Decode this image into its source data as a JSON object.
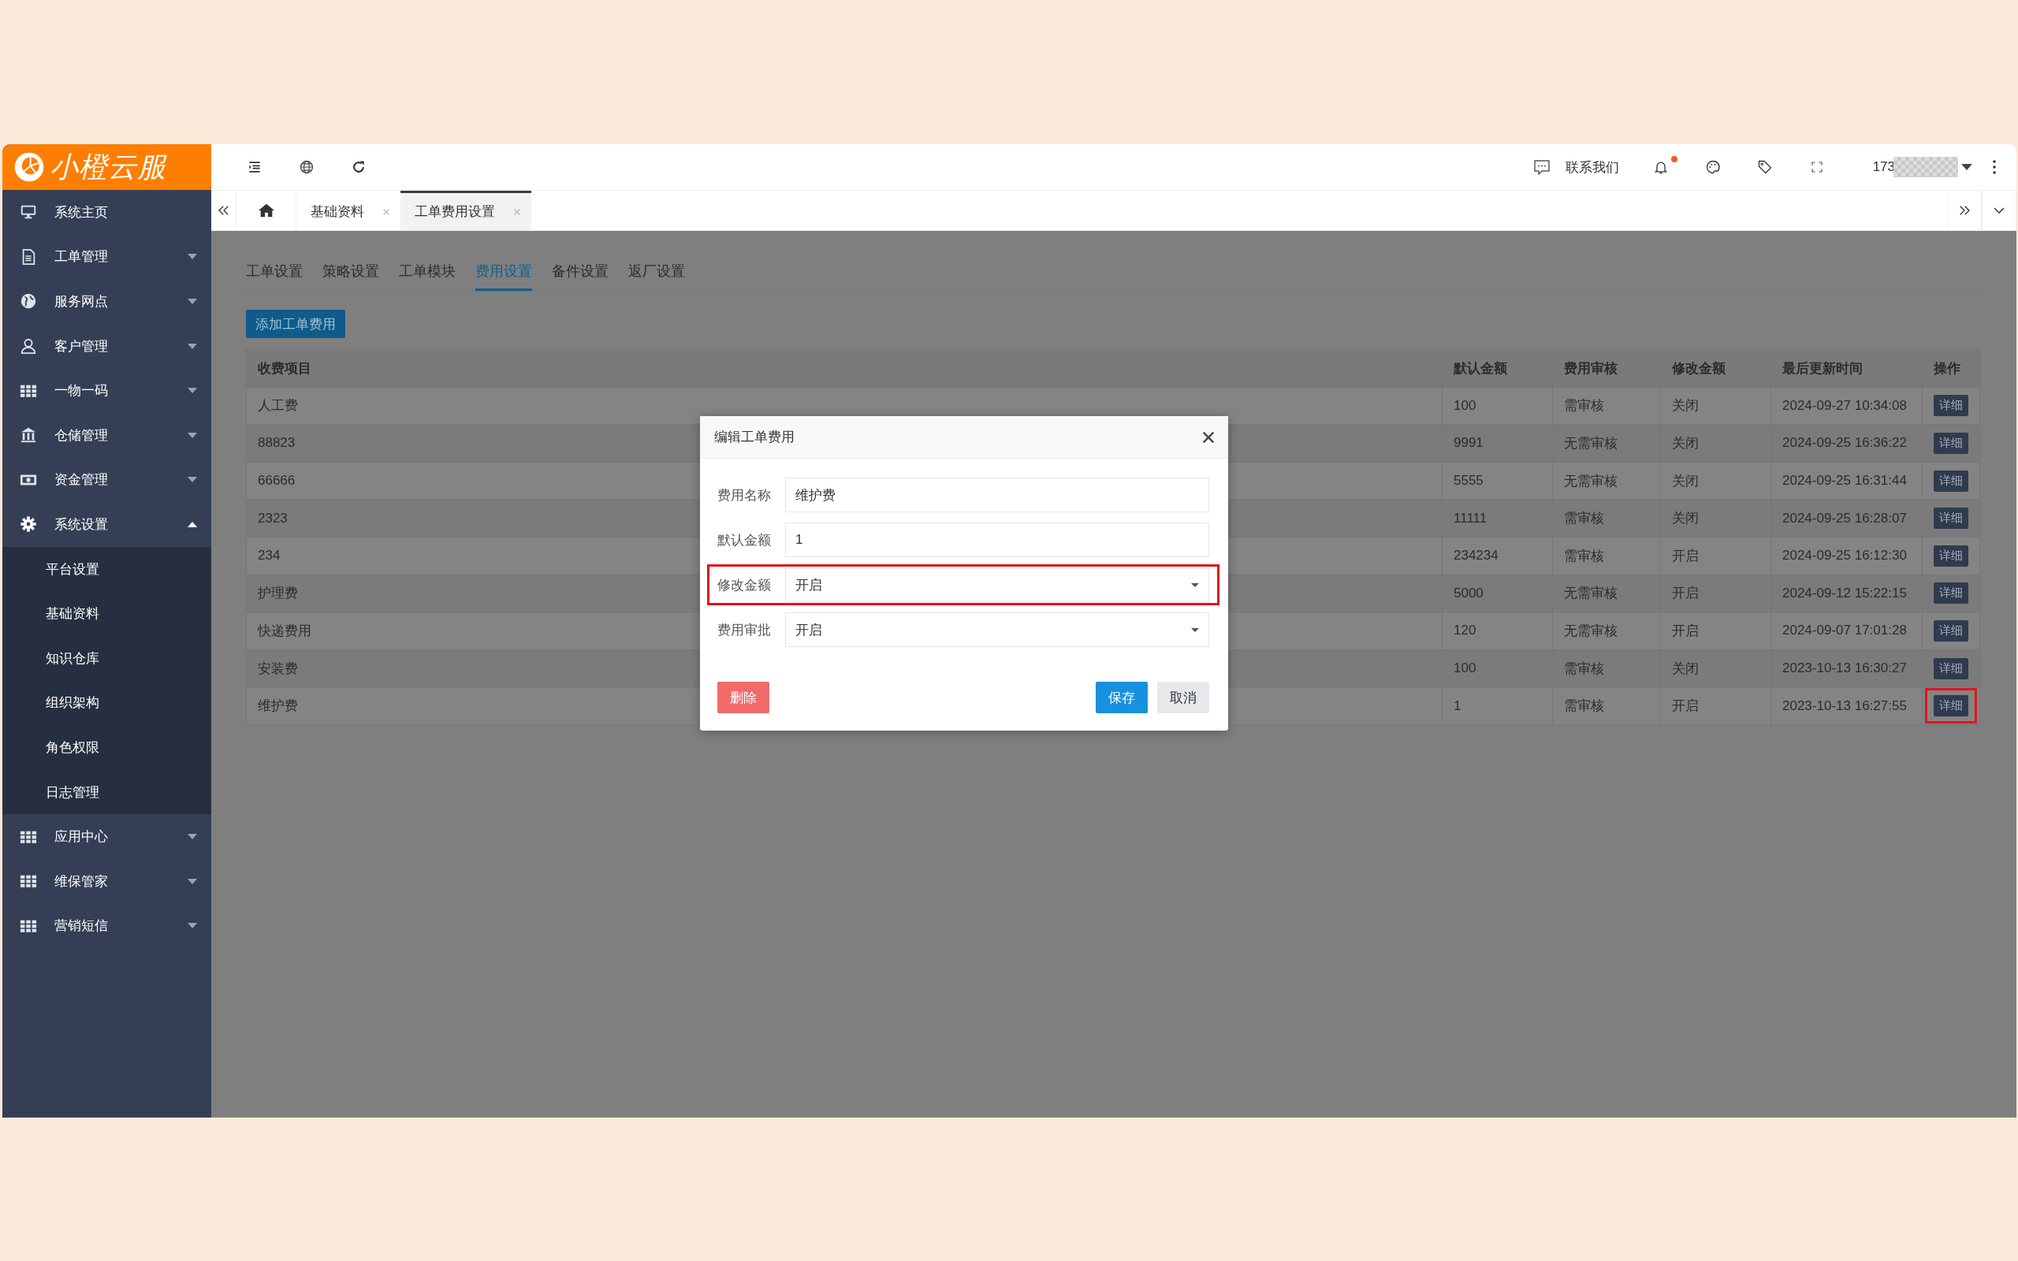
{
  "brand": {
    "name": "小橙云服"
  },
  "sidebar": {
    "items": [
      {
        "label": "系统主页",
        "kind": "link"
      },
      {
        "label": "工单管理",
        "kind": "menu",
        "expanded": false
      },
      {
        "label": "服务网点",
        "kind": "menu",
        "expanded": false
      },
      {
        "label": "客户管理",
        "kind": "menu",
        "expanded": false
      },
      {
        "label": "一物一码",
        "kind": "menu",
        "expanded": false
      },
      {
        "label": "仓储管理",
        "kind": "menu",
        "expanded": false
      },
      {
        "label": "资金管理",
        "kind": "menu",
        "expanded": false
      },
      {
        "label": "系统设置",
        "kind": "menu",
        "expanded": true,
        "children": [
          {
            "label": "平台设置"
          },
          {
            "label": "基础资料"
          },
          {
            "label": "知识仓库"
          },
          {
            "label": "组织架构"
          },
          {
            "label": "角色权限"
          },
          {
            "label": "日志管理"
          }
        ]
      },
      {
        "label": "应用中心",
        "kind": "menu",
        "expanded": false
      },
      {
        "label": "维保管家",
        "kind": "menu",
        "expanded": false
      },
      {
        "label": "营销短信",
        "kind": "menu",
        "expanded": false
      }
    ]
  },
  "topbar": {
    "contact": "联系我们",
    "notifications": {
      "unread": true
    },
    "user": {
      "name": "173",
      "redacted": true
    }
  },
  "page_tabs": [
    {
      "label": "基础资料",
      "selected": false
    },
    {
      "label": "工单费用设置",
      "selected": true
    }
  ],
  "sub_tabs": [
    {
      "label": "工单设置",
      "selected": false
    },
    {
      "label": "策略设置",
      "selected": false
    },
    {
      "label": "工单模块",
      "selected": false
    },
    {
      "label": "费用设置",
      "selected": true
    },
    {
      "label": "备件设置",
      "selected": false
    },
    {
      "label": "返厂设置",
      "selected": false
    }
  ],
  "add_button": "添加工单费用",
  "table": {
    "columns": [
      "收费项目",
      "默认金额",
      "费用审核",
      "修改金额",
      "最后更新时间",
      "操作"
    ],
    "rows": [
      {
        "cells": [
          "人工费",
          "100",
          "需审核",
          "关闭",
          "2024-09-27 10:34:08"
        ],
        "action": "详细",
        "highlighted": false
      },
      {
        "cells": [
          "88823",
          "9991",
          "无需审核",
          "关闭",
          "2024-09-25 16:36:22"
        ],
        "action": "详细",
        "highlighted": false
      },
      {
        "cells": [
          "66666",
          "5555",
          "无需审核",
          "关闭",
          "2024-09-25 16:31:44"
        ],
        "action": "详细",
        "highlighted": false
      },
      {
        "cells": [
          "2323",
          "11111",
          "需审核",
          "关闭",
          "2024-09-25 16:28:07"
        ],
        "action": "详细",
        "highlighted": false
      },
      {
        "cells": [
          "234",
          "234234",
          "需审核",
          "开启",
          "2024-09-25 16:12:30"
        ],
        "action": "详细",
        "highlighted": false
      },
      {
        "cells": [
          "护理费",
          "5000",
          "无需审核",
          "开启",
          "2024-09-12 15:22:15"
        ],
        "action": "详细",
        "highlighted": false
      },
      {
        "cells": [
          "快递费用",
          "120",
          "无需审核",
          "开启",
          "2024-09-07 17:01:28"
        ],
        "action": "详细",
        "highlighted": false
      },
      {
        "cells": [
          "安装费",
          "100",
          "需审核",
          "关闭",
          "2023-10-13 16:30:27"
        ],
        "action": "详细",
        "highlighted": false
      },
      {
        "cells": [
          "维护费",
          "1",
          "需审核",
          "开启",
          "2023-10-13 16:27:55"
        ],
        "action": "详细",
        "highlighted": true
      }
    ]
  },
  "dialog": {
    "title": "编辑工单费用",
    "fields": [
      {
        "label": "费用名称",
        "kind": "input",
        "value": "维护费",
        "highlighted": false
      },
      {
        "label": "默认金额",
        "kind": "input",
        "value": "1",
        "highlighted": false
      },
      {
        "label": "修改金额",
        "kind": "select",
        "value": "开启",
        "highlighted": true
      },
      {
        "label": "费用审批",
        "kind": "select",
        "value": "开启",
        "highlighted": false
      }
    ],
    "buttons": [
      {
        "label": "删除",
        "kind": "danger"
      },
      {
        "label": "保存",
        "kind": "primary"
      },
      {
        "label": "取消",
        "kind": "default"
      }
    ]
  }
}
